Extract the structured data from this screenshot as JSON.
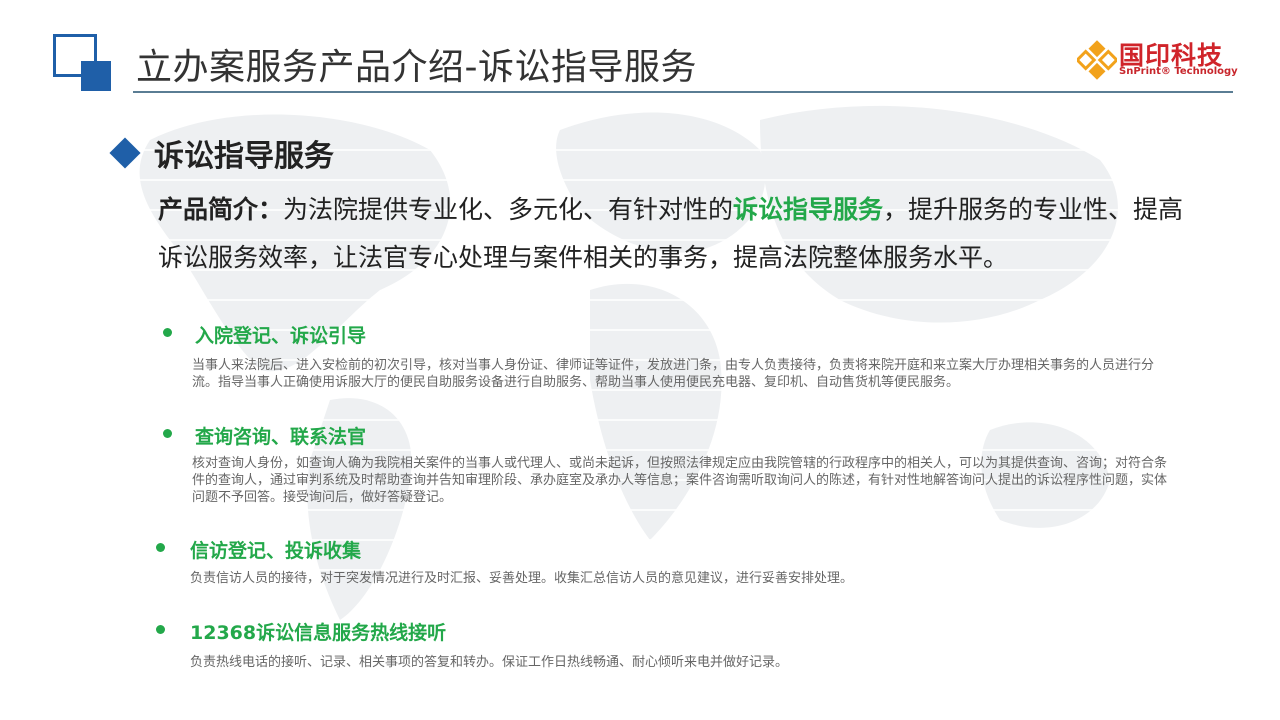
{
  "header": {
    "title": "立办案服务产品介绍-诉讼指导服务",
    "brand_cn": "国印科技",
    "brand_en": "SnPrint® Technology"
  },
  "section": {
    "title": "诉讼指导服务"
  },
  "intro": {
    "label": "产品简介：",
    "pre": "为法院提供专业化、多元化、有针对性的",
    "highlight": "诉讼指导服务",
    "post": "，提升服务的专业性、提高诉讼服务效率，让法官专心处理与案件相关的事务，提高法院整体服务水平。"
  },
  "items": [
    {
      "title": "入院登记、诉讼引导",
      "desc": "当事人来法院后、进入安检前的初次引导，核对当事人身份证、律师证等证件，发放进门条，由专人负责接待，负责将来院开庭和来立案大厅办理相关事务的人员进行分流。指导当事人正确使用诉服大厅的便民自助服务设备进行自助服务、帮助当事人使用便民充电器、复印机、自动售货机等便民服务。"
    },
    {
      "title": "查询咨询、联系法官",
      "desc": "核对查询人身份，如查询人确为我院相关案件的当事人或代理人、或尚未起诉，但按照法律规定应由我院管辖的行政程序中的相关人，可以为其提供查询、咨询；对符合条件的查询人，通过审判系统及时帮助查询并告知审理阶段、承办庭室及承办人等信息；案件咨询需听取询问人的陈述，有针对性地解答询问人提出的诉讼程序性问题，实体问题不予回答。接受询问后，做好答疑登记。"
    },
    {
      "title": "信访登记、投诉收集",
      "desc": "负责信访人员的接待，对于突发情况进行及时汇报、妥善处理。收集汇总信访人员的意见建议，进行妥善安排处理。"
    },
    {
      "title": "12368诉讼信息服务热线接听",
      "desc": "负责热线电话的接听、记录、相关事项的答复和转办。保证工作日热线畅通、耐心倾听来电并做好记录。"
    }
  ],
  "colors": {
    "accent_blue": "#1f5fa8",
    "highlight_green": "#23a84a",
    "brand_red": "#d0242a",
    "brand_orange": "#f2a21b"
  }
}
